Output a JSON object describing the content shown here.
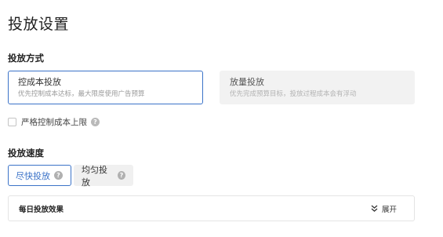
{
  "page": {
    "title": "投放设置"
  },
  "delivery_method": {
    "section_title": "投放方式",
    "options": [
      {
        "name": "控成本投放",
        "description": "优先控制成本达标，最大限度使用广告预算",
        "selected": true
      },
      {
        "name": "放量投放",
        "description": "优先完成预算目标，投放过程成本会有浮动",
        "selected": false
      }
    ],
    "strict_cost_cap": {
      "label": "严格控制成本上限",
      "checked": false
    }
  },
  "delivery_speed": {
    "section_title": "投放速度",
    "options": [
      {
        "label": "尽快投放",
        "selected": true
      },
      {
        "label": "均匀投放",
        "selected": false
      }
    ]
  },
  "daily_effect": {
    "title": "每日投放效果",
    "expand_label": "展开"
  },
  "icons": {
    "help": "question-circle-icon",
    "expand": "double-chevron-down-icon"
  },
  "colors": {
    "accent": "#3b73c8",
    "disabled_bg": "#f2f2f2"
  }
}
